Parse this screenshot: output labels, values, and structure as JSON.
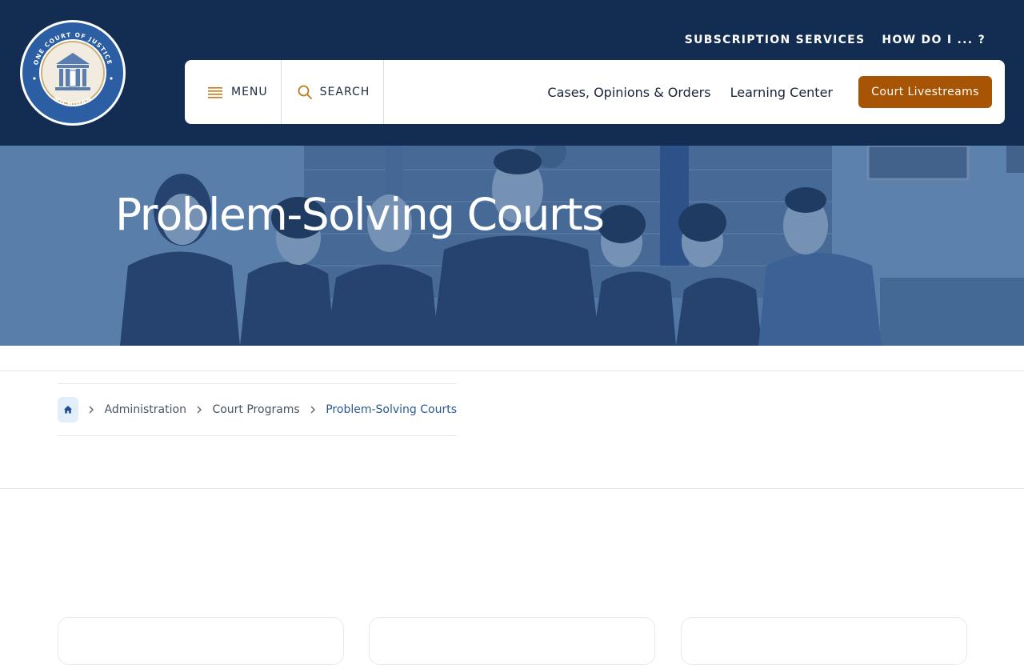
{
  "logo": {
    "ring_top_text": "ONE COURT OF JUSTICE",
    "ring_bottom_text": "MICHIGAN"
  },
  "top_links": {
    "subscription": "SUBSCRIPTION SERVICES",
    "how_do_i": "HOW DO I ... ?"
  },
  "navbar": {
    "menu_label": "MENU",
    "search_label": "SEARCH",
    "links": {
      "cases": "Cases, Opinions & Orders",
      "learning": "Learning Center"
    },
    "livestream_button": "Court Livestreams"
  },
  "hero": {
    "title": "Problem-Solving Courts"
  },
  "breadcrumb": {
    "items": [
      "Administration",
      "Court Programs",
      "Problem-Solving Courts"
    ]
  },
  "colors": {
    "header_bg": "#132d52",
    "accent_orange": "#a75505",
    "hero_overlay": "#2c5a94",
    "link_blue": "#2a5a92"
  },
  "icons": {
    "menu": "hamburger-icon",
    "search": "magnifier-icon",
    "home": "home-icon",
    "separator": "chevron-right-icon"
  }
}
